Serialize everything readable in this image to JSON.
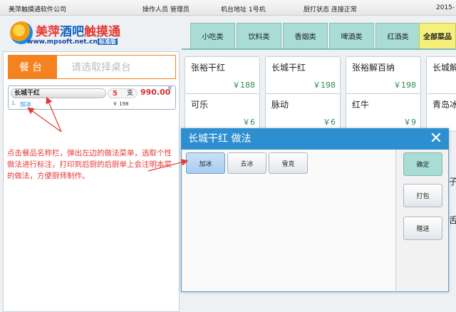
{
  "status": {
    "company": "美萍触摸通软件公司",
    "operator": "操作人员 管理员",
    "terminal": "机台地址 1号机",
    "printer": "厨打状态 连接正常",
    "date": "2015-"
  },
  "logo": {
    "title_a": "美萍",
    "title_b": "酒吧",
    "title_c": "触摸通",
    "url": "www.mpsoft.net.cn",
    "badge": "标准版"
  },
  "tabs": [
    "小吃类",
    "饮料类",
    "香烟类",
    "啤酒类",
    "红酒类",
    "全部菜品"
  ],
  "left": {
    "table_button": "餐台",
    "table_placeholder": "请选取择桌台",
    "order_item": {
      "name": "长城干红",
      "qty": "5",
      "unit": "支",
      "amount": "990.00",
      "line_no": "1.",
      "method": "加冰",
      "unit_price": "￥ 198"
    },
    "close_glyph": "✕"
  },
  "annotation": "点击餐品名称栏，弹出左边的做法菜单，选取个性做法进行标注，打印到后厨的后厨单上会注明本菜的做法，方便厨师制作。",
  "products": [
    {
      "name": "张裕干红",
      "price": "￥188"
    },
    {
      "name": "长城干红",
      "price": "￥198"
    },
    {
      "name": "张裕解百纳",
      "price": "￥198"
    },
    {
      "name": "长城解",
      "price": ""
    },
    {
      "name": "可乐",
      "price": "￥6"
    },
    {
      "name": "脉动",
      "price": "￥6"
    },
    {
      "name": "红牛",
      "price": "￥9"
    },
    {
      "name": "青岛冰",
      "price": ""
    }
  ],
  "dialog": {
    "title": "长城干红  做法",
    "close_glyph": "✕",
    "methods": [
      "加冰",
      "去冰",
      "雪克"
    ],
    "actions": [
      "确定",
      "打包",
      "赠送"
    ]
  },
  "peek_chars": [
    "子",
    "舌"
  ],
  "colors": {
    "accent_orange": "#f58220",
    "dialog_blue": "#2d8fd0",
    "tab_teal": "#a8dcd5",
    "price_green": "#2e8b57"
  }
}
